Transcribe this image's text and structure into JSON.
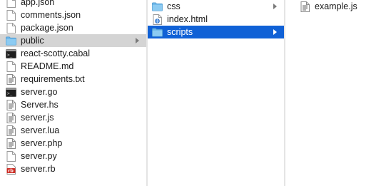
{
  "columns": [
    {
      "items": [
        {
          "label": "app.json",
          "icon": "document-icon"
        },
        {
          "label": "comments.json",
          "icon": "document-icon"
        },
        {
          "label": "package.json",
          "icon": "document-icon"
        },
        {
          "label": "public",
          "icon": "folder-icon",
          "selected": "inactive",
          "has_children": true
        },
        {
          "label": "react-scotty.cabal",
          "icon": "terminal-icon"
        },
        {
          "label": "README.md",
          "icon": "document-icon"
        },
        {
          "label": "requirements.txt",
          "icon": "text-document-icon"
        },
        {
          "label": "server.go",
          "icon": "terminal-icon"
        },
        {
          "label": "Server.hs",
          "icon": "text-document-icon"
        },
        {
          "label": "server.js",
          "icon": "text-document-icon"
        },
        {
          "label": "server.lua",
          "icon": "text-document-icon"
        },
        {
          "label": "server.php",
          "icon": "text-document-icon"
        },
        {
          "label": "server.py",
          "icon": "document-icon"
        },
        {
          "label": "server.rb",
          "icon": "ruby-icon"
        }
      ]
    },
    {
      "items": [
        {
          "label": "css",
          "icon": "folder-icon",
          "has_children": true
        },
        {
          "label": "index.html",
          "icon": "html-document-icon"
        },
        {
          "label": "scripts",
          "icon": "folder-icon",
          "selected": "active",
          "has_children": true
        }
      ]
    },
    {
      "items": [
        {
          "label": "example.js",
          "icon": "text-document-icon"
        }
      ]
    }
  ],
  "colors": {
    "selection_active": "#1061d6",
    "selection_inactive": "#d4d4d4",
    "folder": "#6cb6e8",
    "ruby_badge": "#cc2a22"
  }
}
